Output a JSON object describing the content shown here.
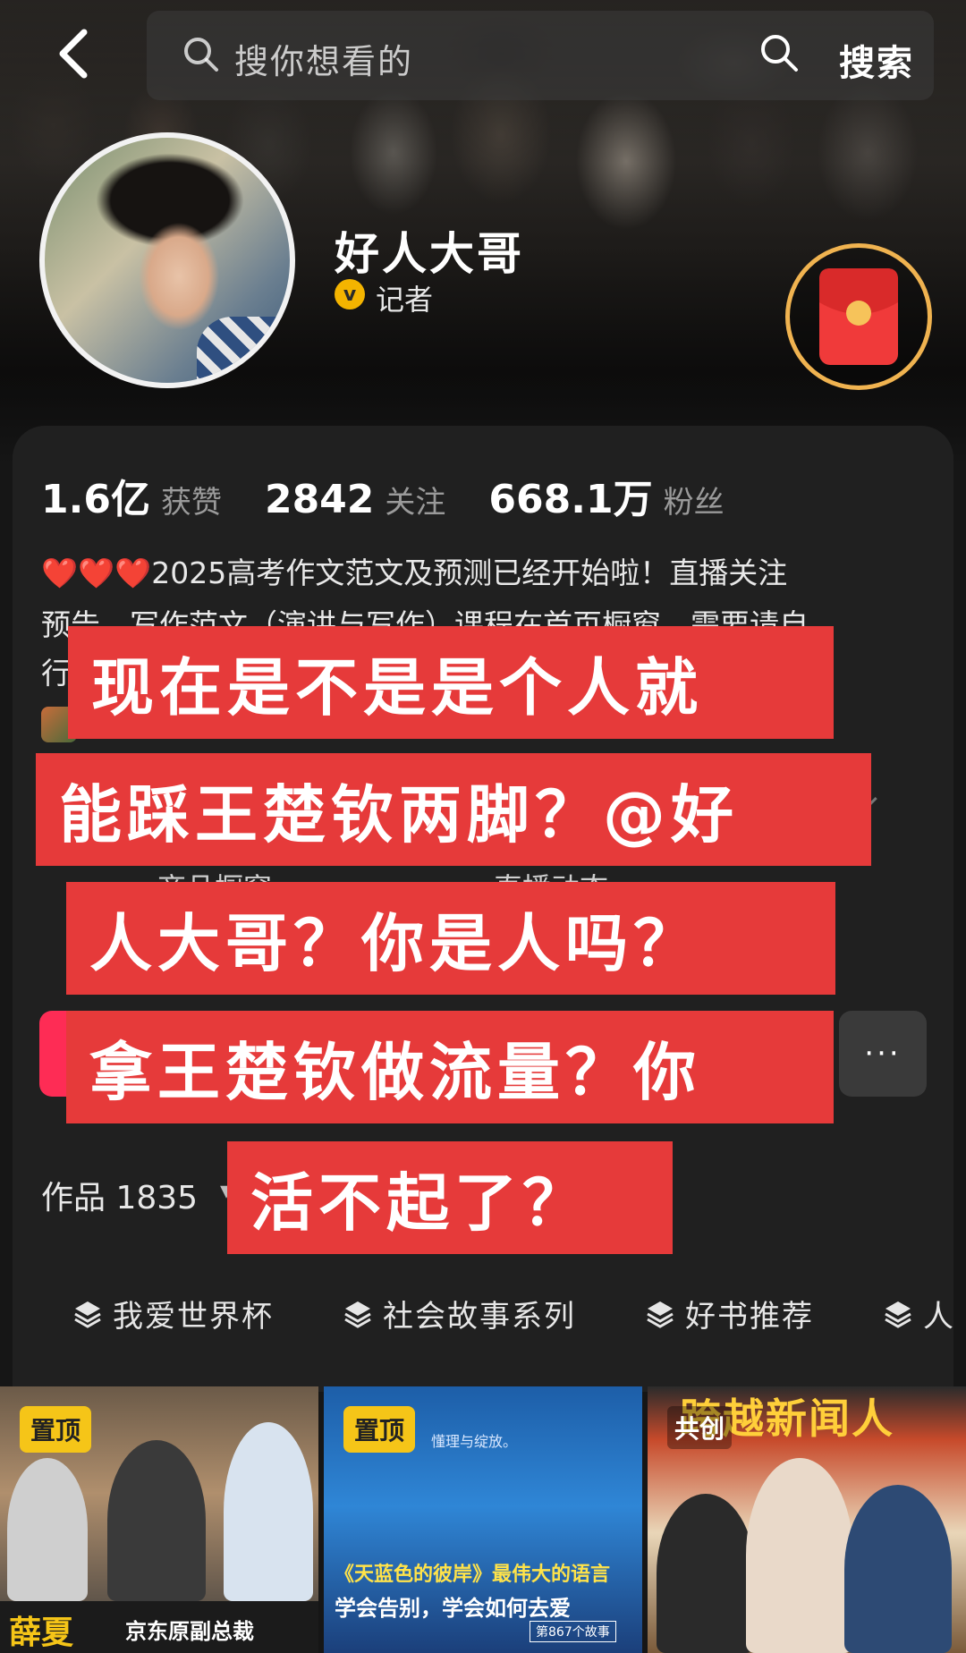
{
  "header": {
    "search_placeholder": "搜你想看的",
    "search_button": "搜索"
  },
  "profile": {
    "name": "好人大哥",
    "verify_badge": "v",
    "verify_label": "记者",
    "stats": [
      {
        "value": "1.6亿",
        "label": "获赞"
      },
      {
        "value": "2842",
        "label": "关注"
      },
      {
        "value": "668.1万",
        "label": "粉丝"
      }
    ],
    "bio_hearts": "❤️❤️❤️",
    "bio_line1": "2025高考作文范文及预测已经开始啦！直播关注",
    "bio_line2": "预告，写作范文（演讲与写作）课程在首页橱窗，需要请自",
    "bio_line3": "行",
    "tab_shop": "商品橱窗",
    "tab_live": "直播动态",
    "more_icon_text": "···",
    "works_label": "作品 1835"
  },
  "collections": [
    {
      "label": "我爱世界杯",
      "icon": "stack-icon"
    },
    {
      "label": "社会故事系列",
      "icon": "stack-icon"
    },
    {
      "label": "好书推荐",
      "icon": "stack-icon"
    },
    {
      "label": "人",
      "icon": "stack-icon"
    }
  ],
  "overlay_caption": [
    "现在是不是是个人就",
    "能踩王楚钦两脚？@好",
    "人大哥？你是人吗？",
    "拿王楚钦做流量？你",
    "活不起了？"
  ],
  "thumbnails": [
    {
      "badge": "置顶",
      "banner_big": "薛夏",
      "banner_small": "京东原副总裁"
    },
    {
      "badge": "置顶",
      "top_text": "懂理与绽放。",
      "title": "《天蓝色的彼岸》最伟大的语言",
      "subtitle": "学会告别，学会如何去爱",
      "tag": "第867个故事"
    },
    {
      "badge": "共创",
      "banner": "跨越新闻人"
    }
  ],
  "colors": {
    "accent_red": "#fe2c55",
    "overlay_red": "#e63a3a",
    "pin_yellow": "#f5c518",
    "verify_gold": "#f4b400"
  }
}
